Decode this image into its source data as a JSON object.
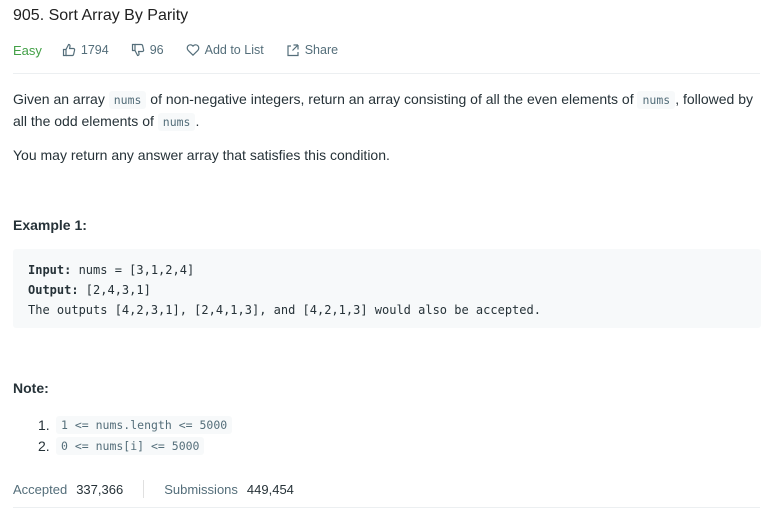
{
  "problem": {
    "title": "905. Sort Array By Parity",
    "difficulty": "Easy",
    "likes": "1794",
    "dislikes": "96",
    "add_to_list": "Add to List",
    "share": "Share"
  },
  "description": {
    "p1_a": "Given an array ",
    "p1_code1": "nums",
    "p1_b": " of non-negative integers, return an array consisting of all the even elements of ",
    "p1_code2": "nums",
    "p1_c": ", followed by all the odd elements of ",
    "p1_code3": "nums",
    "p1_d": ".",
    "p2": "You may return any answer array that satisfies this condition."
  },
  "example": {
    "heading": "Example 1:",
    "input_label": "Input:",
    "input_value": " nums = [3,1,2,4]",
    "output_label": "Output:",
    "output_value": " [2,4,3,1]",
    "explanation": "The outputs [4,2,3,1], [2,4,1,3], and [4,2,1,3] would also be accepted."
  },
  "note": {
    "heading": "Note:",
    "items": [
      {
        "num": "1.",
        "code": "1 <= nums.length <= 5000"
      },
      {
        "num": "2.",
        "code": "0 <= nums[i] <= 5000"
      }
    ]
  },
  "stats": {
    "accepted_label": "Accepted",
    "accepted_value": "337,366",
    "submissions_label": "Submissions",
    "submissions_value": "449,454"
  },
  "colors": {
    "easy": "#43a047",
    "muted": "#546e7a",
    "code_bg": "#f7f9fa"
  },
  "icons": [
    "thumbs-up-icon",
    "thumbs-down-icon",
    "heart-icon",
    "share-icon"
  ]
}
